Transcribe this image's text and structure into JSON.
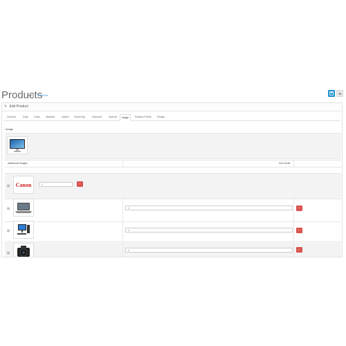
{
  "header": {
    "title": "Products",
    "breadcrumb": [
      "Home",
      "Products"
    ],
    "save_icon": "save-icon",
    "back_icon": "reply-icon"
  },
  "panel": {
    "heading": "Edit Product",
    "heading_icon": "pencil-icon"
  },
  "tabs": [
    "General",
    "Data",
    "Links",
    "Attribute",
    "Option",
    "Recurring",
    "Discount",
    "Special",
    "Image",
    "Reward Points",
    "Design"
  ],
  "active_tab": "Image",
  "image_section": {
    "label": "Image",
    "thumbnail": "monitor-image"
  },
  "additional_images": {
    "column_image": "Additional Images",
    "column_sort": "Sort Order",
    "rows": [
      {
        "thumbnail": "canon-logo-image",
        "sort_order": "1"
      },
      {
        "thumbnail": "laptop-image",
        "sort_order": "1"
      },
      {
        "thumbnail": "desktop-computer-image",
        "sort_order": "1"
      },
      {
        "thumbnail": "camera-image",
        "sort_order": "1"
      }
    ]
  },
  "colors": {
    "primary": "#1e91cf",
    "danger": "#d9534f",
    "link": "#3a8fd0"
  }
}
